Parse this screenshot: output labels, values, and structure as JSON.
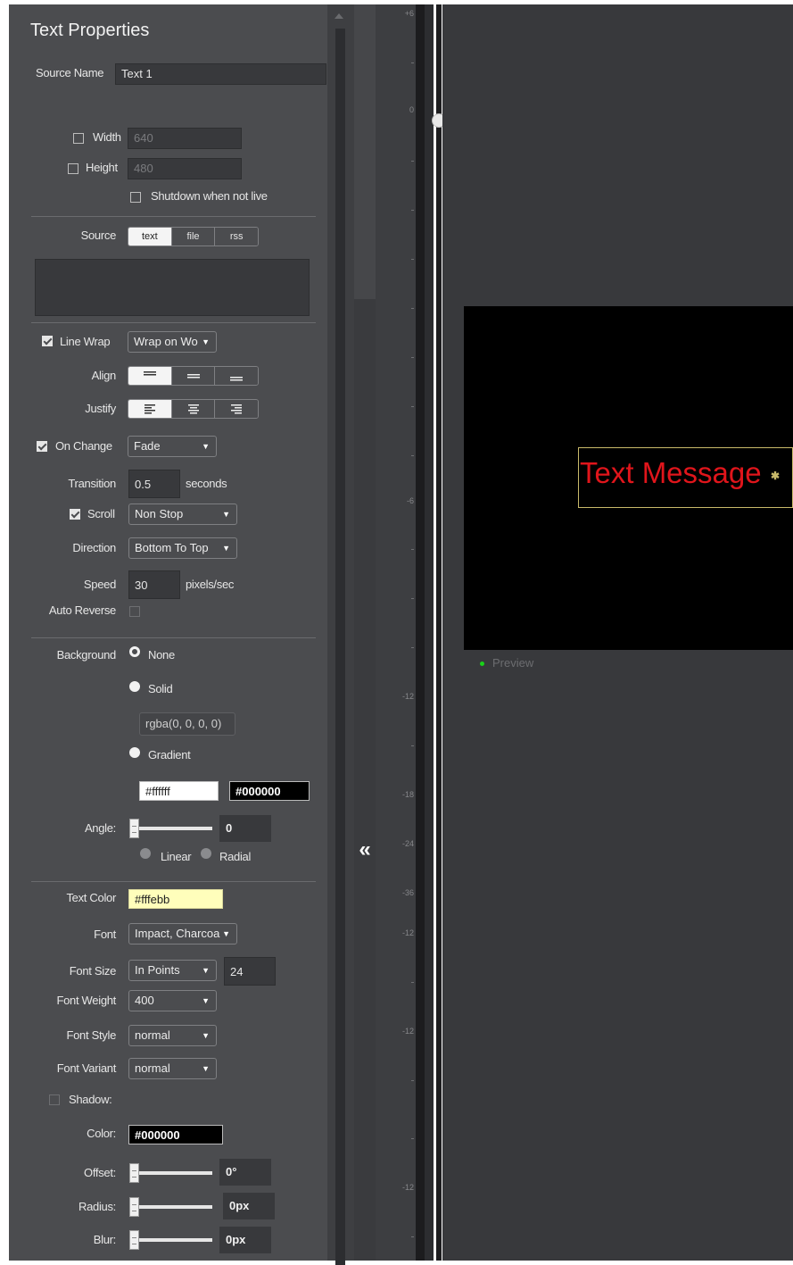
{
  "panel": {
    "title": "Text Properties",
    "source_name": {
      "label": "Source Name",
      "value": "Text 1"
    },
    "width": {
      "label": "Width",
      "value": "640"
    },
    "height": {
      "label": "Height",
      "value": "480"
    },
    "shutdown_label": "Shutdown when not live",
    "source": {
      "label": "Source",
      "tabs": [
        "text",
        "file",
        "rss"
      ],
      "active": "text",
      "text_value": ""
    },
    "line_wrap": {
      "label": "Line Wrap",
      "checked": true,
      "value": "Wrap on Wo"
    },
    "align_label": "Align",
    "justify_label": "Justify",
    "on_change": {
      "label": "On Change",
      "checked": true,
      "value": "Fade"
    },
    "transition": {
      "label": "Transition",
      "value": "0.5",
      "unit": "seconds"
    },
    "scroll": {
      "label": "Scroll",
      "checked": true,
      "value": "Non Stop"
    },
    "direction": {
      "label": "Direction",
      "value": "Bottom To Top"
    },
    "speed": {
      "label": "Speed",
      "value": "30",
      "unit": "pixels/sec"
    },
    "auto_reverse_label": "Auto Reverse",
    "background": {
      "label": "Background",
      "options": [
        "None",
        "Solid",
        "Gradient"
      ],
      "selected": "None",
      "solid_color": "rgba(0, 0, 0, 0)",
      "gradient_from": "#ffffff",
      "gradient_to": "#000000",
      "angle_label": "Angle:",
      "angle_value": "0",
      "gradient_types": [
        "Linear",
        "Radial"
      ]
    },
    "text_color": {
      "label": "Text Color",
      "value": "#fffebb"
    },
    "font": {
      "label": "Font",
      "value": "Impact, Charcoa"
    },
    "font_size": {
      "label": "Font Size",
      "unit_value": "In Points",
      "value": "24"
    },
    "font_weight": {
      "label": "Font Weight",
      "value": "400"
    },
    "font_style": {
      "label": "Font Style",
      "value": "normal"
    },
    "font_variant": {
      "label": "Font Variant",
      "value": "normal"
    },
    "shadow": {
      "label": "Shadow:",
      "color_label": "Color:",
      "color_value": "#000000",
      "offset_label": "Offset:",
      "offset_value": "0°",
      "radius_label": "Radius:",
      "radius_value": "0px",
      "blur_label": "Blur:",
      "blur_value": "0px"
    }
  },
  "collapse_glyph": "«",
  "ruler_labels": [
    "+6",
    "0",
    "-6",
    "-12",
    "-18",
    "-24",
    "-36",
    "-12",
    "-12",
    "-12"
  ],
  "preview": {
    "text": "Text Message",
    "label": "Preview"
  },
  "colors": {
    "panel_bg": "#4b4c4f",
    "stage_bg": "#38393c",
    "preview_text": "#e0151b",
    "preview_dot": "#19d219",
    "selection_box": "#c8b96a"
  }
}
